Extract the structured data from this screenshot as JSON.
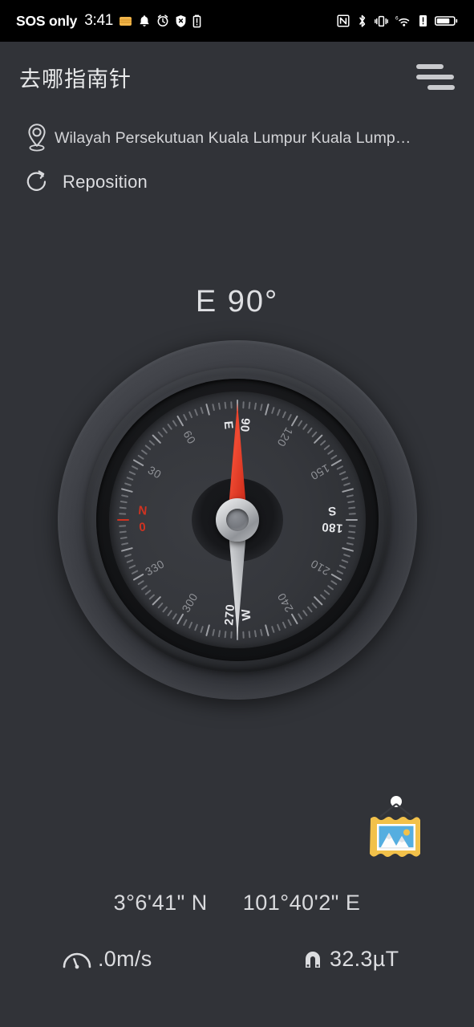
{
  "status_bar": {
    "carrier": "SOS only",
    "time": "3:41",
    "left_icons": [
      "wallet-icon",
      "bell-icon",
      "alarm-clock-icon",
      "shield-off-icon",
      "battery-alert-icon"
    ],
    "right_icons": [
      "nfc-icon",
      "bluetooth-icon",
      "vibrate-icon",
      "wifi6-icon",
      "sim-alert-icon",
      "battery-icon"
    ]
  },
  "header": {
    "app_title": "去哪指南针",
    "menu_icon": "hamburger-menu-icon"
  },
  "location": {
    "pin_icon": "location-pin-icon",
    "text": "Wilayah Persekutuan Kuala Lumpur Kuala Lump…"
  },
  "reposition": {
    "refresh_icon": "refresh-icon",
    "label": "Reposition"
  },
  "heading": {
    "display": "E  90°",
    "direction": "E",
    "degrees": 90
  },
  "compass": {
    "dial_rotation_deg": -90,
    "needle_angle_deg": 0,
    "needle_color": "#e0321d",
    "tail_color": "#cdcfd2",
    "north_marker_color": "#cf3321",
    "labels": [
      {
        "deg": 0,
        "text": "0",
        "type": "north"
      },
      {
        "deg": 0,
        "text": "N",
        "type": "north-letter"
      },
      {
        "deg": 30,
        "text": "30",
        "type": "minor"
      },
      {
        "deg": 60,
        "text": "60",
        "type": "minor"
      },
      {
        "deg": 90,
        "text": "E",
        "type": "cardinal"
      },
      {
        "deg": 90,
        "text": "90",
        "type": "cardinal-num"
      },
      {
        "deg": 120,
        "text": "120",
        "type": "minor"
      },
      {
        "deg": 150,
        "text": "150",
        "type": "minor"
      },
      {
        "deg": 180,
        "text": "S",
        "type": "cardinal"
      },
      {
        "deg": 180,
        "text": "180",
        "type": "cardinal-num"
      },
      {
        "deg": 210,
        "text": "210",
        "type": "minor"
      },
      {
        "deg": 240,
        "text": "240",
        "type": "minor"
      },
      {
        "deg": 270,
        "text": "W",
        "type": "cardinal"
      },
      {
        "deg": 270,
        "text": "270",
        "type": "cardinal-num"
      },
      {
        "deg": 300,
        "text": "300",
        "type": "minor"
      },
      {
        "deg": 330,
        "text": "330",
        "type": "minor"
      }
    ]
  },
  "picture_button": {
    "icon": "framed-picture-icon",
    "frame_color": "#f2c14a",
    "sky_color": "#55aee0"
  },
  "coordinates": {
    "latitude": "3°6'41\" N",
    "longitude": "101°40'2\" E"
  },
  "metrics": {
    "speed": {
      "icon": "speedometer-icon",
      "value": ".0m/s"
    },
    "magnetic": {
      "icon": "magnet-icon",
      "value": "32.3µT"
    }
  },
  "theme": {
    "background": "#313338",
    "text_primary": "#dcdde0",
    "accent_red": "#cf3321"
  }
}
